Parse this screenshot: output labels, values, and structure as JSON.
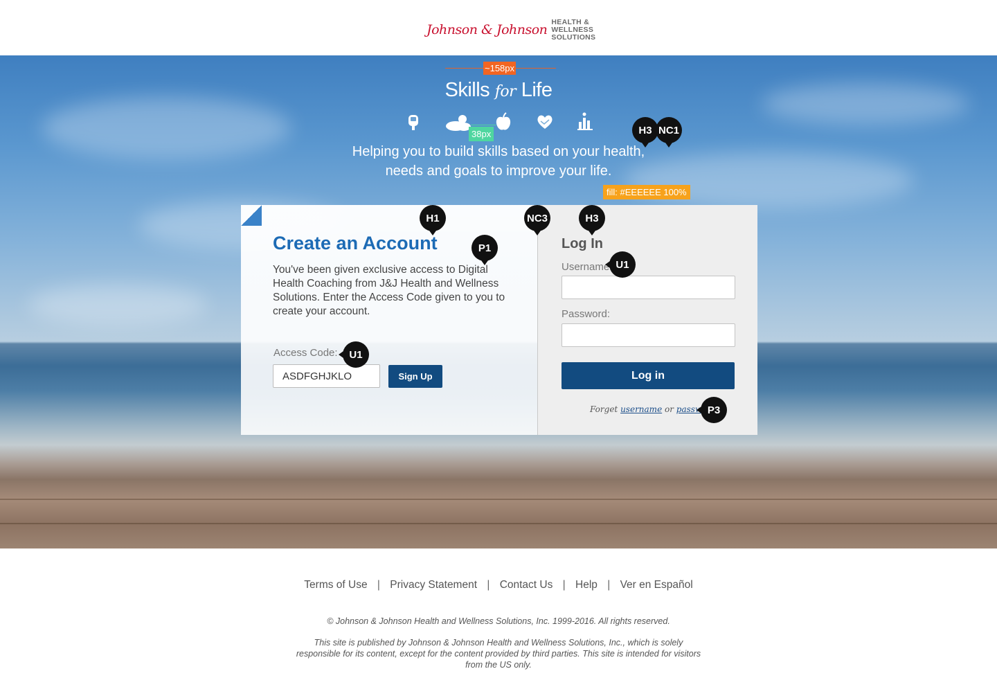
{
  "header": {
    "logo_script": "Johnson & Johnson",
    "logo_tagline_1": "HEALTH &",
    "logo_tagline_2": "WELLNESS",
    "logo_tagline_3": "SOLUTIONS"
  },
  "hero": {
    "brand_main": "Skills",
    "brand_for": "for",
    "brand_end": "Life",
    "tagline_line1": "Helping you to build skills based on your health,",
    "tagline_line2": "needs and goals to improve your life.",
    "icons": [
      "glucose-meter-icon",
      "weather-icon",
      "apple-icon",
      "heart-hands-icon",
      "bar-chart-icon"
    ]
  },
  "annotations": {
    "width_measure": "~158px",
    "icon_gap": "38px",
    "fill_note": "fill: #EEEEEE 100%",
    "pins": {
      "h3_top": "H3",
      "nc1_top": "NC1",
      "h1": "H1",
      "nc3": "NC3",
      "h3_login": "H3",
      "p1": "P1",
      "u1_username": "U1",
      "u1_access": "U1",
      "p3": "P3"
    }
  },
  "create_account": {
    "title": "Create an Account",
    "description": "You've been given exclusive access to Digital Health Coaching from J&J Health and Wellness Solutions.  Enter the Access Code given to you to create your account.",
    "access_label": "Access Code:",
    "access_value": "ASDFGHJKLO",
    "signup_label": "Sign Up"
  },
  "login": {
    "title": "Log In",
    "username_label": "Username:",
    "username_value": "",
    "password_label": "Password:",
    "password_value": "",
    "button_label": "Log in",
    "forgot_prefix": "Forget",
    "forgot_username": "username",
    "forgot_or": "or",
    "forgot_password": "password"
  },
  "footer": {
    "links": [
      "Terms of Use",
      "Privacy Statement",
      "Contact Us",
      "Help",
      "Ver en Español"
    ],
    "separator": "|",
    "copyright": "© Johnson & Johnson Health and Wellness Solutions, Inc. 1999-2016. All rights reserved.",
    "disclaimer": "This site is published by Johnson & Johnson Health and Wellness Solutions, Inc., which is solely responsible for its content, except for the content provided by third parties.  This site is intended for visitors from the US only."
  },
  "colors": {
    "brand_red": "#c8102e",
    "primary_blue": "#124b80",
    "title_blue": "#1d6bb5",
    "panel_fill": "#EEEEEE",
    "annotation_orange": "#f26522",
    "annotation_green": "#4fd6a0"
  }
}
